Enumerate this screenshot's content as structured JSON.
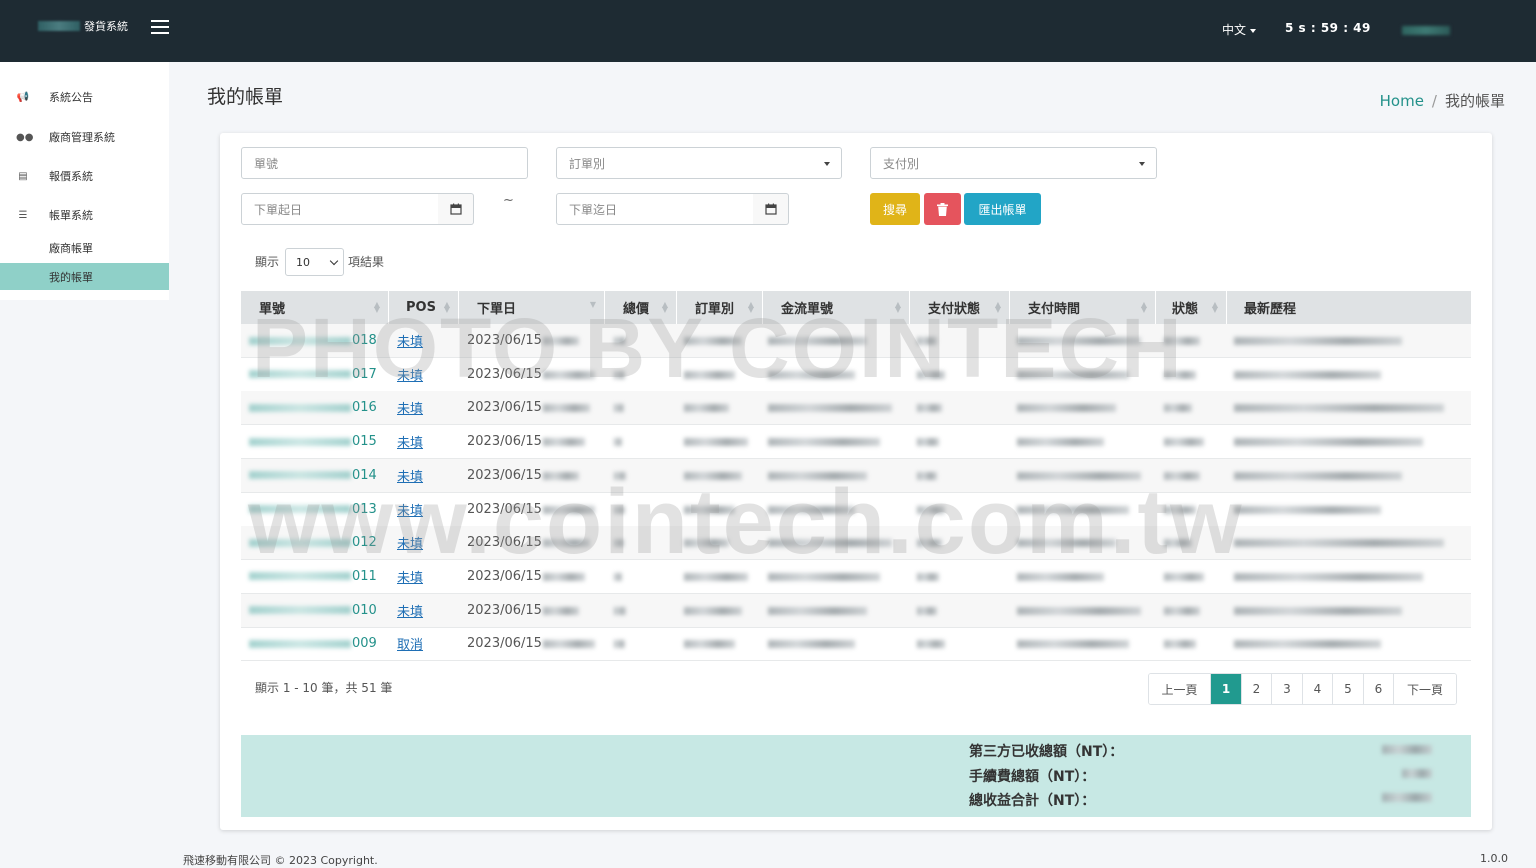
{
  "topbar": {
    "brand_text": "發貨系統",
    "language": "中文",
    "session_timer": "5 s : 59 : 49"
  },
  "sidebar": {
    "items": [
      {
        "label": "系統公告",
        "icon": "megaphone-icon"
      },
      {
        "label": "廠商管理系統",
        "icon": "users-icon"
      },
      {
        "label": "報價系統",
        "icon": "quote-icon"
      },
      {
        "label": "帳單系統",
        "icon": "bill-icon"
      }
    ],
    "subitems": [
      {
        "label": "廠商帳單",
        "active": false
      },
      {
        "label": "我的帳單",
        "active": true
      }
    ]
  },
  "page": {
    "title": "我的帳單",
    "breadcrumb_home": "Home",
    "breadcrumb_current": "我的帳單"
  },
  "filters": {
    "order_no_placeholder": "單號",
    "order_type_placeholder": "訂單別",
    "payment_type_placeholder": "支付別",
    "date_from_placeholder": "下單起日",
    "date_to_placeholder": "下單迄日",
    "range_separator": "~",
    "search_label": "搜尋",
    "delete_icon": "trash-icon",
    "export_label": "匯出帳單"
  },
  "length_menu": {
    "prefix": "顯示",
    "value": "10",
    "suffix": "項結果"
  },
  "table": {
    "columns": [
      "單號",
      "POS",
      "下單日",
      "總價",
      "訂單別",
      "金流單號",
      "支付狀態",
      "支付時間",
      "狀態",
      "最新歷程"
    ],
    "rows": [
      {
        "order_suffix": "018",
        "pos": "未填",
        "date": "2023/06/15"
      },
      {
        "order_suffix": "017",
        "pos": "未填",
        "date": "2023/06/15"
      },
      {
        "order_suffix": "016",
        "pos": "未填",
        "date": "2023/06/15"
      },
      {
        "order_suffix": "015",
        "pos": "未填",
        "date": "2023/06/15"
      },
      {
        "order_suffix": "014",
        "pos": "未填",
        "date": "2023/06/15"
      },
      {
        "order_suffix": "013",
        "pos": "未填",
        "date": "2023/06/15"
      },
      {
        "order_suffix": "012",
        "pos": "未填",
        "date": "2023/06/15"
      },
      {
        "order_suffix": "011",
        "pos": "未填",
        "date": "2023/06/15"
      },
      {
        "order_suffix": "010",
        "pos": "未填",
        "date": "2023/06/15"
      },
      {
        "order_suffix": "009",
        "pos": "取消",
        "date": "2023/06/15"
      }
    ]
  },
  "table_info": "顯示 1 - 10 筆，共 51 筆",
  "pagination": {
    "prev": "上一頁",
    "pages": [
      "1",
      "2",
      "3",
      "4",
      "5",
      "6"
    ],
    "current": "1",
    "next": "下一頁"
  },
  "summary": {
    "third_party_total_label": "第三方已收總額（NT）：",
    "fee_total_label": "手續費總額（NT）：",
    "revenue_total_label": "總收益合計（NT）："
  },
  "footer": {
    "copyright": "飛速移動有限公司 © 2023 Copyright.",
    "version": "1.0.0"
  },
  "watermark": {
    "line1": "PHOTO BY COINTECH",
    "line2": "www.cointech.com.tw"
  }
}
